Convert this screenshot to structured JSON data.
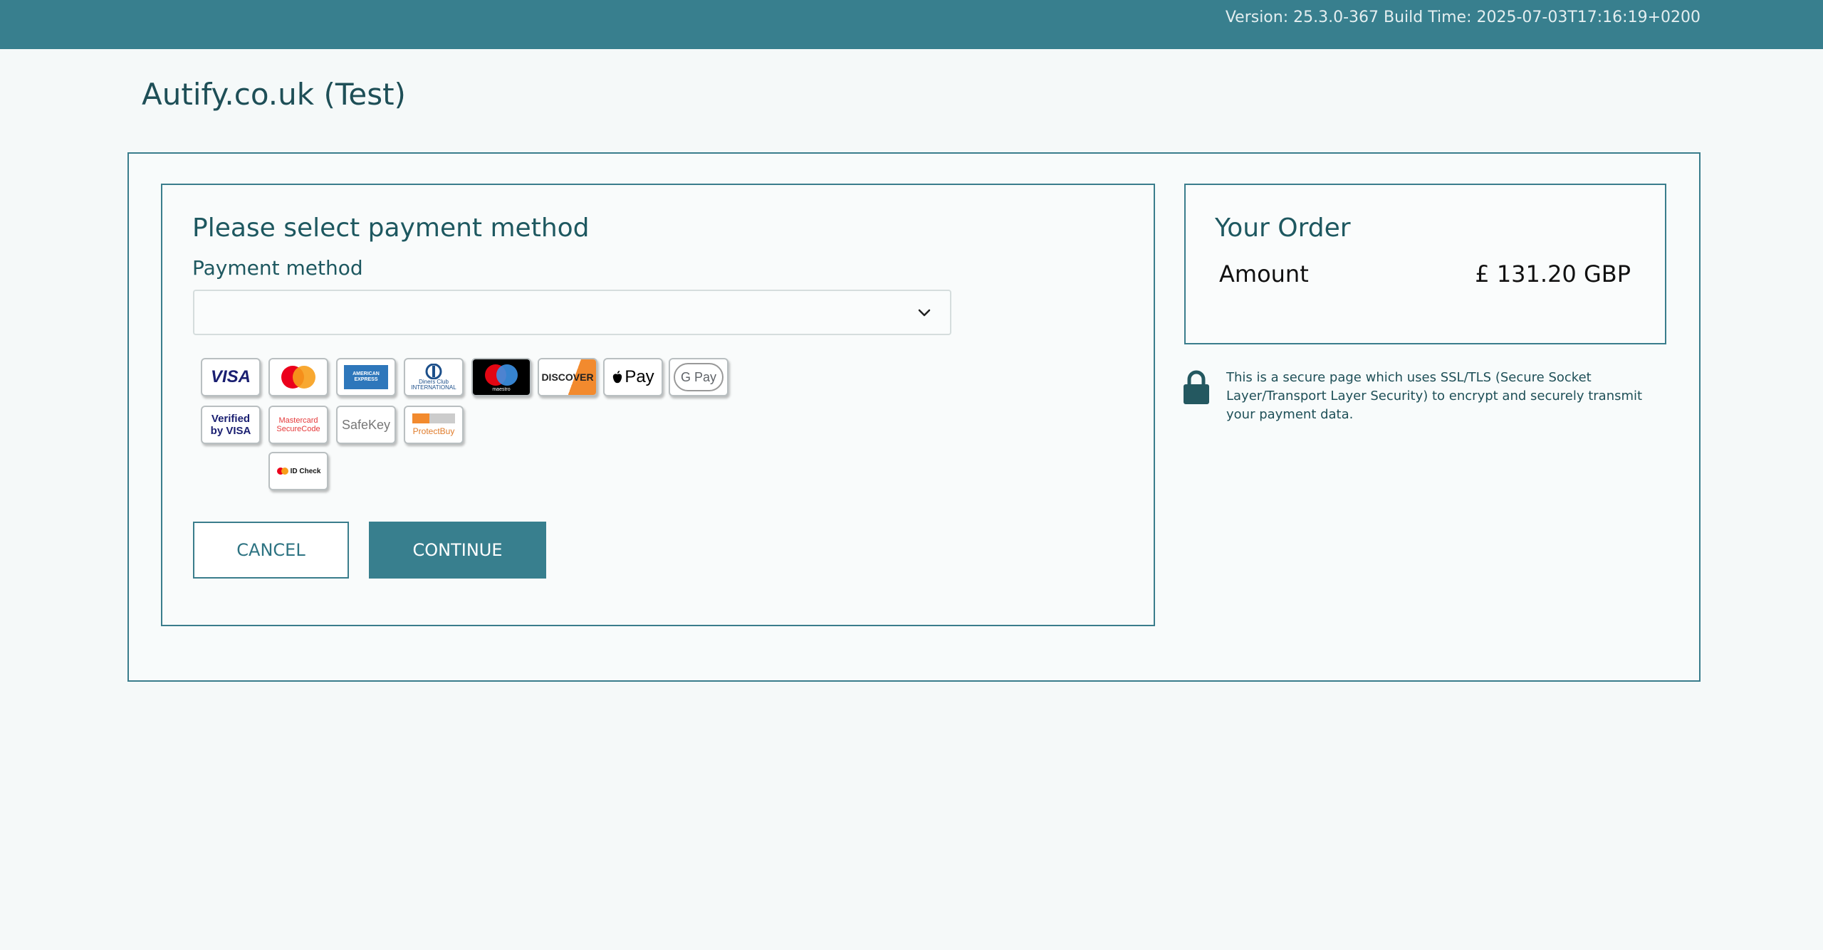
{
  "header": {
    "version": "Version: 25.3.0-367 Build Time: 2025-07-03T17:16:19+0200"
  },
  "merchant": "Autify.co.uk (Test)",
  "payment": {
    "title": "Please select payment method",
    "method_label": "Payment method",
    "select_value": "",
    "cards": [
      {
        "name": "visa",
        "label": "VISA"
      },
      {
        "name": "mastercard",
        "label": ""
      },
      {
        "name": "american-express",
        "label": "AMERICAN EXPRESS"
      },
      {
        "name": "diners-club",
        "label": "Diners Club INTERNATIONAL"
      },
      {
        "name": "maestro",
        "label": "maestro"
      },
      {
        "name": "discover",
        "label": "DISCOVER"
      },
      {
        "name": "apple-pay",
        "label": "Pay"
      },
      {
        "name": "google-pay",
        "label": "G Pay"
      },
      {
        "name": "verified-by-visa",
        "label": "Verified by VISA"
      },
      {
        "name": "mastercard-securecode",
        "label": "Mastercard SecureCode"
      },
      {
        "name": "amex-safekey",
        "label": "SafeKey"
      },
      {
        "name": "protectbuy",
        "label": "ProtectBuy"
      },
      {
        "name": "mastercard-id-check",
        "label": "ID Check"
      }
    ],
    "cancel_label": "CANCEL",
    "continue_label": "CONTINUE"
  },
  "order": {
    "title": "Your Order",
    "amount_label": "Amount",
    "amount_value": "£ 131.20 GBP"
  },
  "secure_notice": "This is a secure page which uses SSL/TLS (Secure Socket Layer/Transport Layer Security) to encrypt and securely transmit your payment data.",
  "colors": {
    "header": "#387f8e",
    "accent": "#387f8e",
    "text": "#1e4f57"
  }
}
